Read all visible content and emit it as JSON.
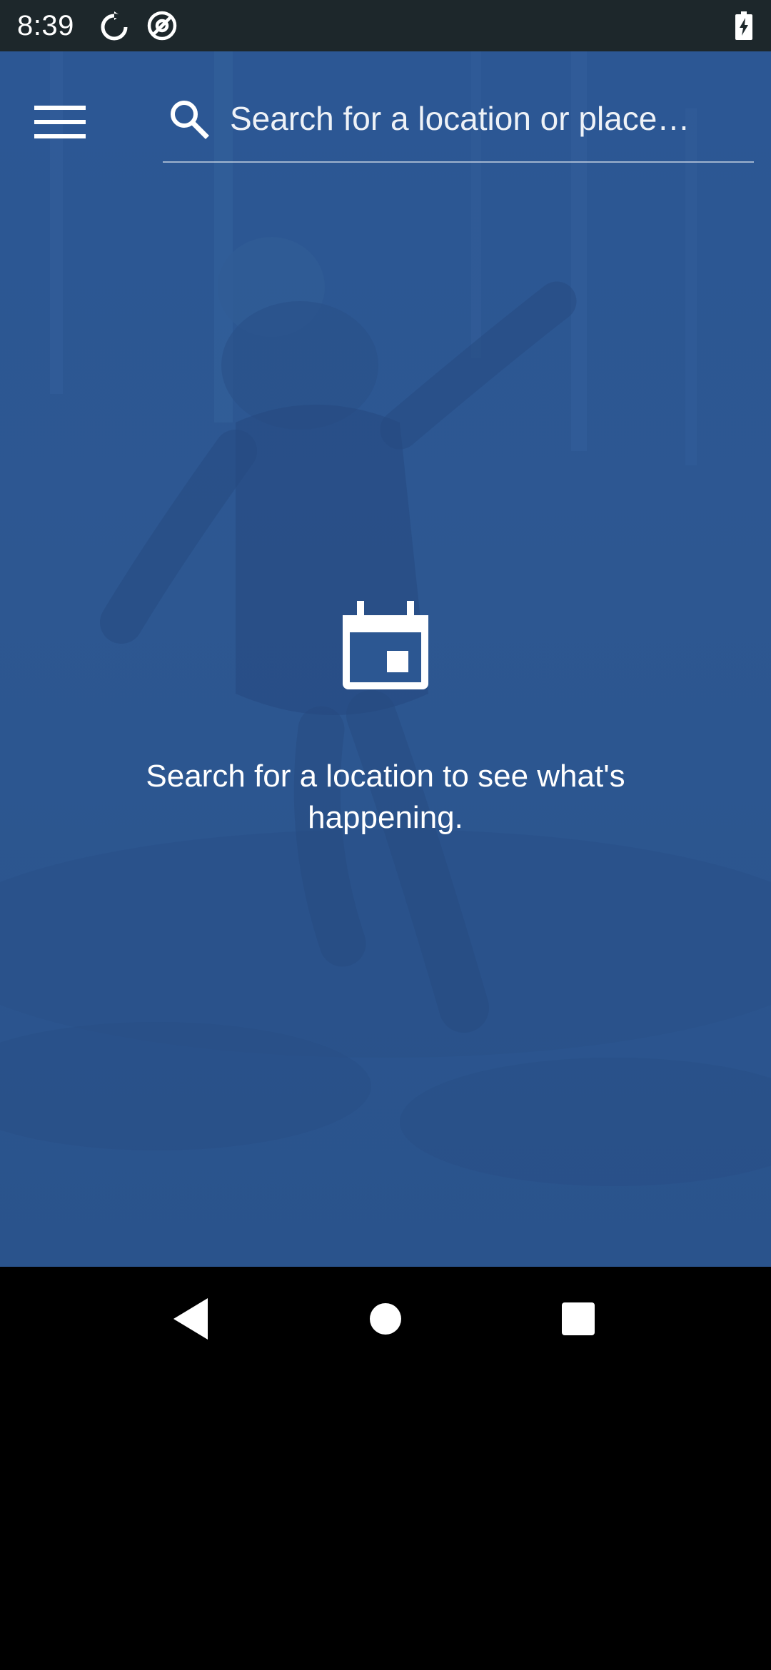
{
  "status_bar": {
    "time": "8:39",
    "icons": [
      "sync-icon",
      "at-sign-icon",
      "battery-charging-icon"
    ]
  },
  "header": {
    "menu_icon": "hamburger-menu-icon",
    "search": {
      "icon": "search-icon",
      "placeholder": "Search for a location or place…",
      "value": ""
    }
  },
  "empty_state": {
    "icon": "calendar-icon",
    "message": "Search for a location to see what's happening."
  },
  "nav_bar": {
    "buttons": [
      "back-icon",
      "home-icon",
      "recents-icon"
    ]
  },
  "colors": {
    "status_bar_bg": "#1d272b",
    "content_tint": "#2b5590",
    "text": "#ffffff",
    "nav_bar_bg": "#000000"
  }
}
